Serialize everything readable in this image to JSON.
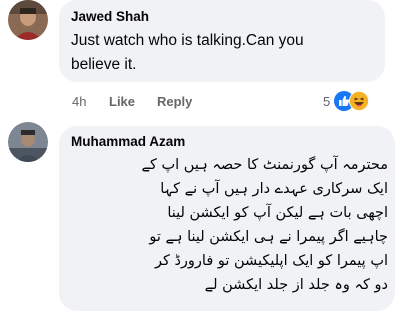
{
  "comments": [
    {
      "author": "Jawed Shah",
      "text_lines": [
        "Just watch who is talking.Can you",
        "believe it."
      ],
      "time": "4h",
      "like_label": "Like",
      "reply_label": "Reply",
      "reaction_count": "5",
      "reactions": [
        "like-reaction-icon",
        "haha-reaction-icon"
      ]
    },
    {
      "author": "Muhammad Azam",
      "text_lines": [
        "محترمہ آپ گورنمنٹ کا حصہ ہیں اپ کے",
        "ایک سرکاری عہدے دار ہیں آپ نے کہا",
        "اچھی بات ہے لیکن آپ کو ایکشن لینا",
        "چاہیے اگر پیمرا نے ہی ایکشن لینا ہے تو",
        "اپ پیمرا کو ایک اپلیکیشن تو فارورڈ کر",
        "دو کہ وہ جلد از جلد ایکشن لے"
      ]
    }
  ],
  "colors": {
    "bubble": "#f0f2f5",
    "meta": "#65676b",
    "like_blue": "#1877f2",
    "haha_yellow": "#f7b125"
  }
}
